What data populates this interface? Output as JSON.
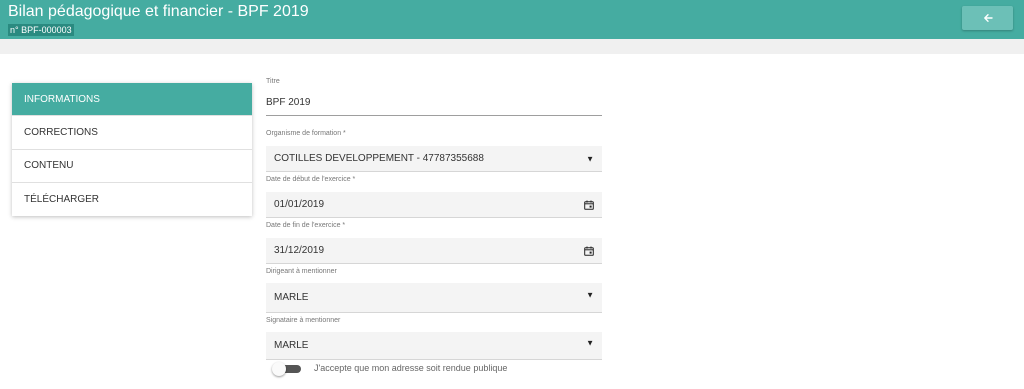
{
  "header": {
    "title": "Bilan pédagogique et financier - BPF 2019",
    "reference": "n° BPF-000003",
    "back_icon": "arrow-left-icon"
  },
  "menu": {
    "items": [
      {
        "label": "INFORMATIONS",
        "active": true
      },
      {
        "label": "CORRECTIONS",
        "active": false
      },
      {
        "label": "CONTENU",
        "active": false
      },
      {
        "label": "TÉLÉCHARGER",
        "active": false
      }
    ]
  },
  "form": {
    "titre": {
      "label": "Titre",
      "value": "BPF 2019"
    },
    "organisme": {
      "label": "Organisme de formation *",
      "value": "COTILLES DEVELOPPEMENT - 47787355688",
      "icon": "dropdown-arrow-icon"
    },
    "date_debut": {
      "label": "Date de début de l'exercice *",
      "value": "01/01/2019",
      "icon": "calendar-icon"
    },
    "date_fin": {
      "label": "Date de fin de l'exercice *",
      "value": "31/12/2019",
      "icon": "calendar-icon"
    },
    "dirigeant": {
      "label": "Dirigeant à mentionner",
      "value": "MARLE",
      "icon": "dropdown-arrow-icon"
    },
    "signataire": {
      "label": "Signataire à mentionner",
      "value": "MARLE",
      "icon": "dropdown-arrow-icon"
    },
    "adresse_publique": {
      "label": "J'accepte que mon adresse soit rendue publique",
      "checked": false
    }
  },
  "colors": {
    "header": "#45aca1",
    "active_menu": "#45aca1",
    "back_button": "#6cc0b7"
  }
}
